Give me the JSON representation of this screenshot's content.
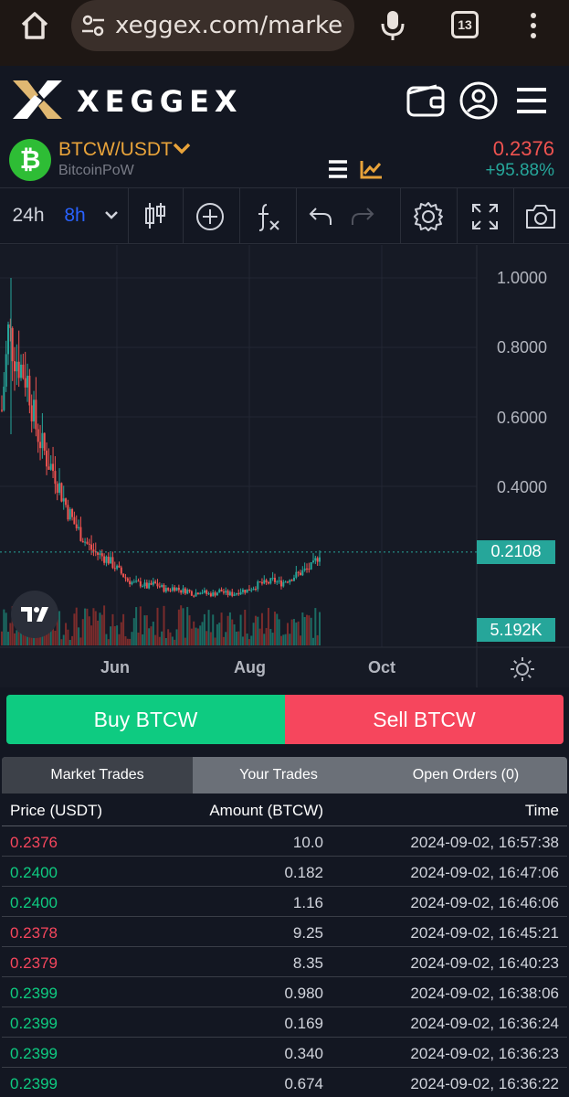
{
  "browser": {
    "url": "xeggex.com/market/B",
    "tab_count": "13"
  },
  "header": {
    "logo_text": "XEGGEX"
  },
  "pair": {
    "name": "BTCW/USDT",
    "subtitle": "BitcoinPoW",
    "price": "0.2376",
    "change": "+95.88%",
    "coin_symbol": "₿"
  },
  "toolbar": {
    "interval_24h": "24h",
    "interval_8h": "8h"
  },
  "chart": {
    "price_labels": [
      "1.0000",
      "0.8000",
      "0.6000",
      "0.4000"
    ],
    "last_price_tag": "0.2108",
    "volume_tag": "5.192K",
    "date_labels": [
      "Jun",
      "Aug",
      "Oct"
    ],
    "colors": {
      "up": "#26a69a",
      "down": "#ef5350",
      "volume_up": "#1b6b63",
      "volume_down": "#7a2c2c"
    }
  },
  "chart_data": {
    "type": "candlestick",
    "x_ticks": [
      "Jun",
      "Aug",
      "Oct"
    ],
    "y_ticks": [
      1.0,
      0.8,
      0.6,
      0.4
    ],
    "ylim": [
      0.05,
      1.1
    ],
    "current_price": 0.2108,
    "volume": "5.192K",
    "close_series": [
      0.62,
      0.85,
      0.78,
      0.74,
      0.7,
      0.58,
      0.52,
      0.47,
      0.44,
      0.38,
      0.33,
      0.29,
      0.26,
      0.23,
      0.21,
      0.2,
      0.19,
      0.17,
      0.15,
      0.13,
      0.12,
      0.12,
      0.11,
      0.12,
      0.11,
      0.1,
      0.11,
      0.1,
      0.1,
      0.09,
      0.1,
      0.09,
      0.09,
      0.1,
      0.09,
      0.09,
      0.1,
      0.1,
      0.11,
      0.12,
      0.12,
      0.13,
      0.12,
      0.13,
      0.14,
      0.15,
      0.16,
      0.17,
      0.21
    ]
  },
  "actions": {
    "buy_label": "Buy BTCW",
    "sell_label": "Sell BTCW"
  },
  "trade_tabs": [
    "Market Trades",
    "Your Trades",
    "Open Orders (0)"
  ],
  "trades": {
    "headers": {
      "price": "Price (USDT)",
      "amount": "Amount (BTCW)",
      "time": "Time"
    },
    "rows": [
      {
        "price": "0.2376",
        "amount": "10.0",
        "time": "2024-09-02, 16:57:38",
        "side": "down"
      },
      {
        "price": "0.2400",
        "amount": "0.182",
        "time": "2024-09-02, 16:47:06",
        "side": "up"
      },
      {
        "price": "0.2400",
        "amount": "1.16",
        "time": "2024-09-02, 16:46:06",
        "side": "up"
      },
      {
        "price": "0.2378",
        "amount": "9.25",
        "time": "2024-09-02, 16:45:21",
        "side": "down"
      },
      {
        "price": "0.2379",
        "amount": "8.35",
        "time": "2024-09-02, 16:40:23",
        "side": "down"
      },
      {
        "price": "0.2399",
        "amount": "0.980",
        "time": "2024-09-02, 16:38:06",
        "side": "up"
      },
      {
        "price": "0.2399",
        "amount": "0.169",
        "time": "2024-09-02, 16:36:24",
        "side": "up"
      },
      {
        "price": "0.2399",
        "amount": "0.340",
        "time": "2024-09-02, 16:36:23",
        "side": "up"
      },
      {
        "price": "0.2399",
        "amount": "0.674",
        "time": "2024-09-02, 16:36:22",
        "side": "up"
      }
    ]
  }
}
